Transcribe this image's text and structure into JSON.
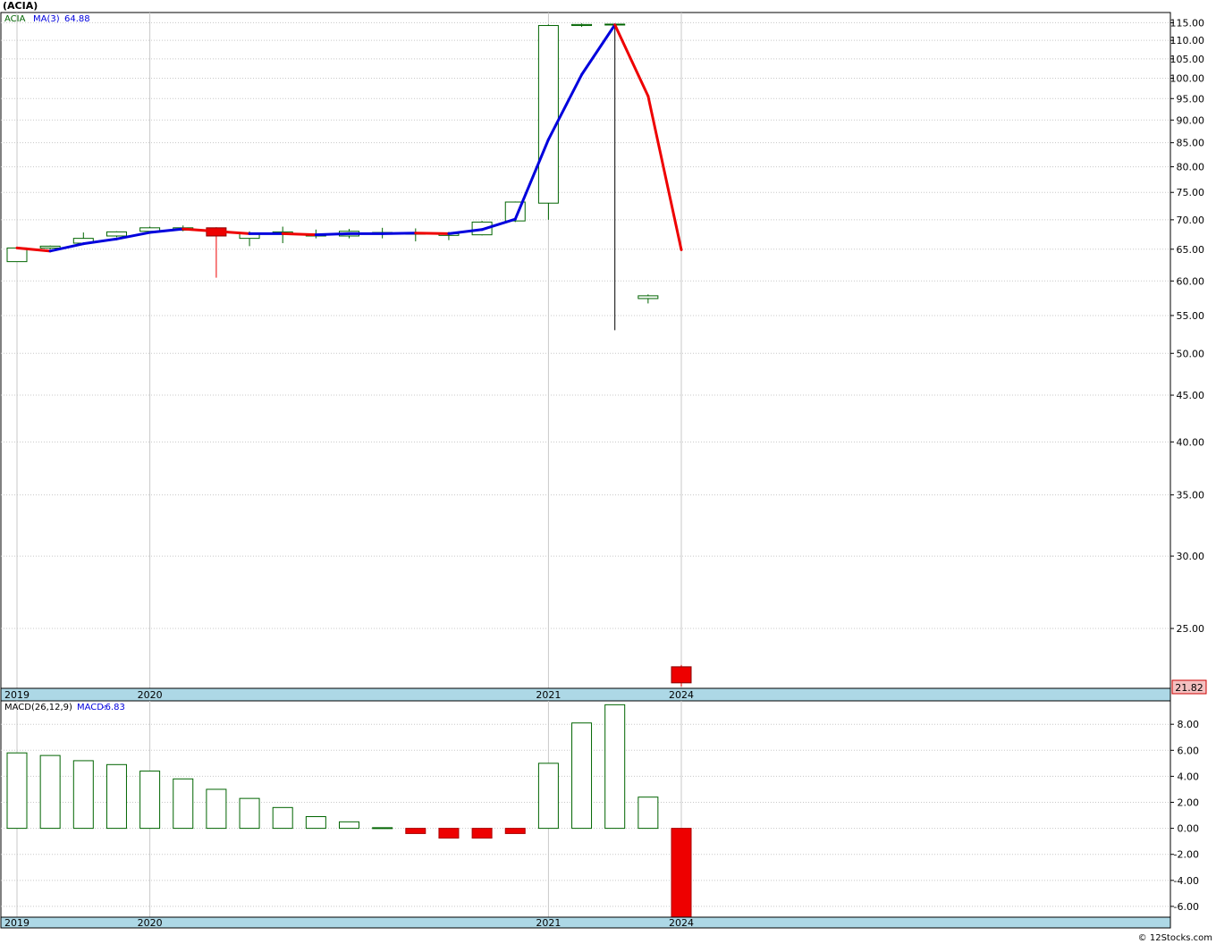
{
  "header": {
    "title": "(ACIA)",
    "symbol_label": "ACIA",
    "ma_label": "MA(3)",
    "ma_value": "64.88",
    "macd_params": "MACD(26,12,9)",
    "macd_label": "MACD:",
    "macd_value": "-6.83",
    "footer": "© 12Stocks.com"
  },
  "colors": {
    "up": "#006400",
    "down": "#ee0000",
    "ma_up": "#0000dd",
    "ma_down": "#ee0000",
    "grid": "#c8c8c8",
    "date_bar": "#add8e6",
    "last_price_bg": "#f4c0c0"
  },
  "chart_data": [
    {
      "type": "candlestick",
      "title": "(ACIA)",
      "y_scale": "log",
      "ylim": [
        21.5,
        118
      ],
      "y_ticks": [
        "25.00",
        "30.00",
        "35.00",
        "40.00",
        "45.00",
        "50.00",
        "55.00",
        "60.00",
        "65.00",
        "70.00",
        "75.00",
        "80.00",
        "85.00",
        "90.00",
        "95.00",
        "100.00",
        "105.00",
        "110.00",
        "115.00"
      ],
      "x_tick_labels": [
        {
          "label": "2019",
          "index": 0
        },
        {
          "label": "2020",
          "index": 4
        },
        {
          "label": "2021",
          "index": 16
        },
        {
          "label": "2024",
          "index": 20
        }
      ],
      "last_price": "21.82",
      "candles": [
        {
          "o": 63.0,
          "h": 65.3,
          "l": 63.0,
          "c": 65.2
        },
        {
          "o": 65.2,
          "h": 65.6,
          "l": 65.0,
          "c": 65.5
        },
        {
          "o": 66.0,
          "h": 67.8,
          "l": 65.8,
          "c": 66.8
        },
        {
          "o": 67.2,
          "h": 68.0,
          "l": 67.0,
          "c": 67.9
        },
        {
          "o": 68.0,
          "h": 68.8,
          "l": 67.9,
          "c": 68.6
        },
        {
          "o": 68.2,
          "h": 69.0,
          "l": 68.0,
          "c": 68.6
        },
        {
          "o": 68.6,
          "h": 68.7,
          "l": 60.5,
          "c": 67.2
        },
        {
          "o": 66.8,
          "h": 68.0,
          "l": 65.5,
          "c": 67.6
        },
        {
          "o": 67.5,
          "h": 68.8,
          "l": 66.0,
          "c": 67.9
        },
        {
          "o": 67.2,
          "h": 68.3,
          "l": 66.8,
          "c": 67.5
        },
        {
          "o": 67.2,
          "h": 68.4,
          "l": 66.8,
          "c": 68.0
        },
        {
          "o": 67.5,
          "h": 68.6,
          "l": 66.8,
          "c": 67.8
        },
        {
          "o": 67.5,
          "h": 68.5,
          "l": 66.3,
          "c": 67.8
        },
        {
          "o": 67.3,
          "h": 67.9,
          "l": 66.5,
          "c": 67.6
        },
        {
          "o": 67.4,
          "h": 69.8,
          "l": 67.3,
          "c": 69.6
        },
        {
          "o": 69.8,
          "h": 73.3,
          "l": 69.6,
          "c": 73.2
        },
        {
          "o": 73.0,
          "h": 114.5,
          "l": 70.0,
          "c": 114.2
        },
        {
          "o": 114.2,
          "h": 114.8,
          "l": 113.8,
          "c": 114.5
        },
        {
          "o": 114.6,
          "h": 114.7,
          "l": 53.0,
          "c": 114.6
        },
        {
          "o": 57.4,
          "h": 58.0,
          "l": 56.7,
          "c": 57.8
        },
        {
          "o": 22.7,
          "h": 22.8,
          "l": 21.6,
          "c": 21.8
        }
      ],
      "ma": {
        "name": "MA(3)",
        "values": [
          65.2,
          64.7,
          65.9,
          66.7,
          67.8,
          68.4,
          68.0,
          67.6,
          67.6,
          67.4,
          67.6,
          67.6,
          67.7,
          67.6,
          68.3,
          70.1,
          85.7,
          100.9,
          114.4,
          95.6,
          64.9
        ]
      }
    },
    {
      "type": "bar",
      "title": "MACD(26,12,9)",
      "ylim": [
        -6.83,
        9.8
      ],
      "y_ticks": [
        "-6.00",
        "-4.00",
        "-2.00",
        "0.00",
        "2.00",
        "4.00",
        "6.00",
        "8.00"
      ],
      "x_tick_labels": [
        {
          "label": "2019",
          "index": 0
        },
        {
          "label": "2020",
          "index": 4
        },
        {
          "label": "2021",
          "index": 16
        },
        {
          "label": "2024",
          "index": 20
        }
      ],
      "values": [
        5.8,
        5.6,
        5.2,
        4.9,
        4.4,
        3.8,
        3.0,
        2.3,
        1.6,
        0.9,
        0.5,
        0.05,
        -0.4,
        -0.75,
        -0.75,
        -0.4,
        5.0,
        8.1,
        9.5,
        2.4,
        -6.83
      ]
    }
  ]
}
